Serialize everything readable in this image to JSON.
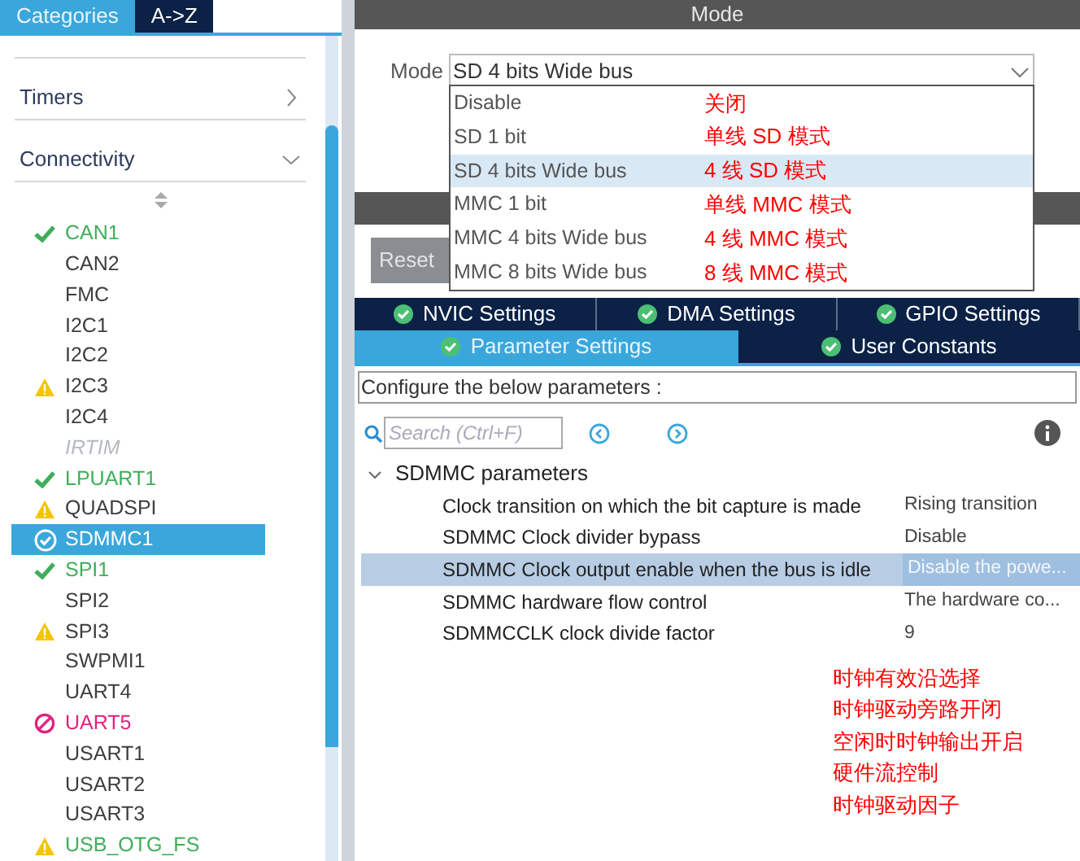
{
  "sidebar": {
    "tabs": [
      {
        "label": "Categories",
        "selected": true
      },
      {
        "label": "A->Z",
        "selected": false
      }
    ],
    "categories": [
      {
        "label": "Timers",
        "expanded": false
      },
      {
        "label": "Connectivity",
        "expanded": true
      }
    ],
    "items": [
      {
        "label": "CAN1",
        "kind": "ok",
        "configured": true,
        "disabled": false,
        "selected": false
      },
      {
        "label": "CAN2",
        "kind": "plain",
        "configured": false,
        "disabled": false,
        "selected": false
      },
      {
        "label": "FMC",
        "kind": "plain",
        "configured": false,
        "disabled": false,
        "selected": false
      },
      {
        "label": "I2C1",
        "kind": "plain",
        "configured": false,
        "disabled": false,
        "selected": false
      },
      {
        "label": "I2C2",
        "kind": "plain",
        "configured": false,
        "disabled": false,
        "selected": false
      },
      {
        "label": "I2C3",
        "kind": "warn",
        "configured": false,
        "disabled": false,
        "selected": false
      },
      {
        "label": "I2C4",
        "kind": "plain",
        "configured": false,
        "disabled": false,
        "selected": false
      },
      {
        "label": "IRTIM",
        "kind": "plain",
        "configured": false,
        "disabled": true,
        "selected": false
      },
      {
        "label": "LPUART1",
        "kind": "ok",
        "configured": true,
        "disabled": false,
        "selected": false
      },
      {
        "label": "QUADSPI",
        "kind": "warn",
        "configured": false,
        "disabled": false,
        "selected": false
      },
      {
        "label": "SDMMC1",
        "kind": "ok",
        "configured": true,
        "disabled": false,
        "selected": true
      },
      {
        "label": "SPI1",
        "kind": "ok",
        "configured": true,
        "disabled": false,
        "selected": false
      },
      {
        "label": "SPI2",
        "kind": "plain",
        "configured": false,
        "disabled": false,
        "selected": false
      },
      {
        "label": "SPI3",
        "kind": "warn",
        "configured": false,
        "disabled": false,
        "selected": false
      },
      {
        "label": "SWPMI1",
        "kind": "plain",
        "configured": false,
        "disabled": false,
        "selected": false
      },
      {
        "label": "UART4",
        "kind": "plain",
        "configured": false,
        "disabled": false,
        "selected": false
      },
      {
        "label": "UART5",
        "kind": "error",
        "configured": false,
        "disabled": false,
        "selected": false
      },
      {
        "label": "USART1",
        "kind": "plain",
        "configured": false,
        "disabled": false,
        "selected": false
      },
      {
        "label": "USART2",
        "kind": "plain",
        "configured": false,
        "disabled": false,
        "selected": false
      },
      {
        "label": "USART3",
        "kind": "plain",
        "configured": false,
        "disabled": false,
        "selected": false
      },
      {
        "label": "USB_OTG_FS",
        "kind": "warn",
        "configured": true,
        "disabled": false,
        "selected": false
      }
    ]
  },
  "mode": {
    "header": "Mode",
    "label": "Mode",
    "value": "SD 4 bits Wide bus",
    "options": [
      {
        "label": "Disable",
        "note": "关闭",
        "selected": false
      },
      {
        "label": "SD 1 bit",
        "note": "单线 SD 模式",
        "selected": false
      },
      {
        "label": "SD 4 bits Wide bus",
        "note": "4 线 SD 模式",
        "selected": true
      },
      {
        "label": "MMC 1 bit",
        "note": "单线 MMC 模式",
        "selected": false
      },
      {
        "label": "MMC 4 bits Wide bus",
        "note": "4 线 MMC 模式",
        "selected": false
      },
      {
        "label": "MMC 8 bits Wide bus",
        "note": "8 线 MMC 模式",
        "selected": false
      }
    ]
  },
  "configuration": {
    "reset_button": "Reset",
    "tabs_row_1": [
      {
        "label": "NVIC Settings",
        "selected": false
      },
      {
        "label": "DMA Settings",
        "selected": false
      },
      {
        "label": "GPIO Settings",
        "selected": false
      }
    ],
    "tabs_row_2": [
      {
        "label": "Parameter Settings",
        "selected": true
      },
      {
        "label": "User Constants",
        "selected": false
      }
    ],
    "hint": "Configure the below parameters :",
    "search": {
      "placeholder": "Search (Ctrl+F)"
    },
    "group": {
      "label": "SDMMC parameters",
      "expanded": true
    },
    "parameters": [
      {
        "name": "Clock transition on which the bit capture is made",
        "value": "Rising transition",
        "selected": false
      },
      {
        "name": "SDMMC Clock divider bypass",
        "value": "Disable",
        "selected": false
      },
      {
        "name": "SDMMC Clock output enable when the bus is idle",
        "value": "Disable the powe...",
        "selected": true
      },
      {
        "name": "SDMMC hardware flow control",
        "value": "The hardware co...",
        "selected": false
      },
      {
        "name": "SDMMCCLK clock divide factor",
        "value": "9",
        "selected": false
      }
    ],
    "annotations": [
      "时钟有效沿选择",
      "时钟驱动旁路开闭",
      "空闲时时钟输出开启",
      "硬件流控制",
      "时钟驱动因子"
    ]
  }
}
